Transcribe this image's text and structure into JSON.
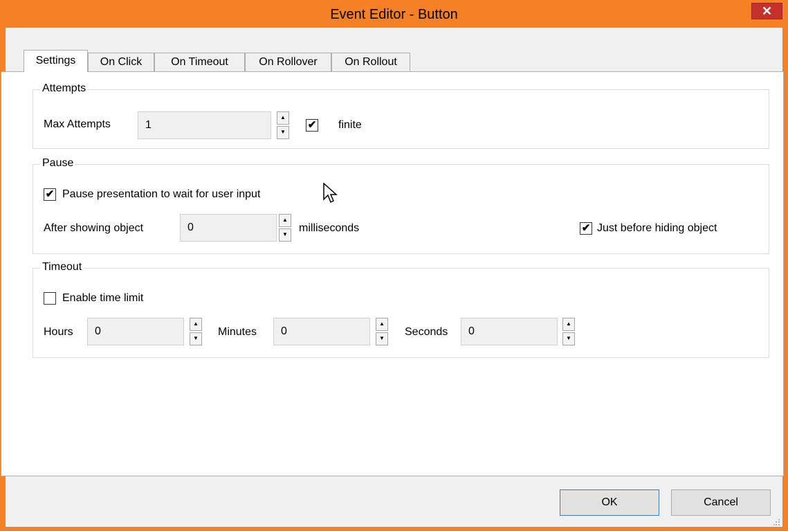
{
  "window": {
    "title": "Event Editor - Button",
    "close_glyph": "✕"
  },
  "tabs": [
    {
      "label": "Settings",
      "active": true
    },
    {
      "label": "On Click"
    },
    {
      "label": "On Timeout"
    },
    {
      "label": "On Rollover"
    },
    {
      "label": "On Rollout"
    }
  ],
  "attempts": {
    "group_label": "Attempts",
    "max_label": "Max Attempts",
    "max_value": "1",
    "infinite_label": "finite",
    "infinite_checked": true
  },
  "pause": {
    "group_label": "Pause",
    "pause_label": "Pause presentation to wait for user input",
    "pause_checked": true,
    "after_label": "After showing object",
    "after_value": "0",
    "ms_label": "milliseconds",
    "before_hide_label": "Just before hiding object",
    "before_hide_checked": true
  },
  "timeout": {
    "group_label": "Timeout",
    "enable_label": "Enable time limit",
    "enable_checked": false,
    "hours_label": "Hours",
    "hours_value": "0",
    "minutes_label": "Minutes",
    "minutes_value": "0",
    "seconds_label": "Seconds",
    "seconds_value": "0"
  },
  "footer": {
    "ok_label": "OK",
    "cancel_label": "Cancel"
  },
  "glyphs": {
    "check": "✔",
    "up": "▲",
    "down": "▼"
  },
  "colors": {
    "titlebar": "#f58025",
    "close": "#c7312b"
  }
}
